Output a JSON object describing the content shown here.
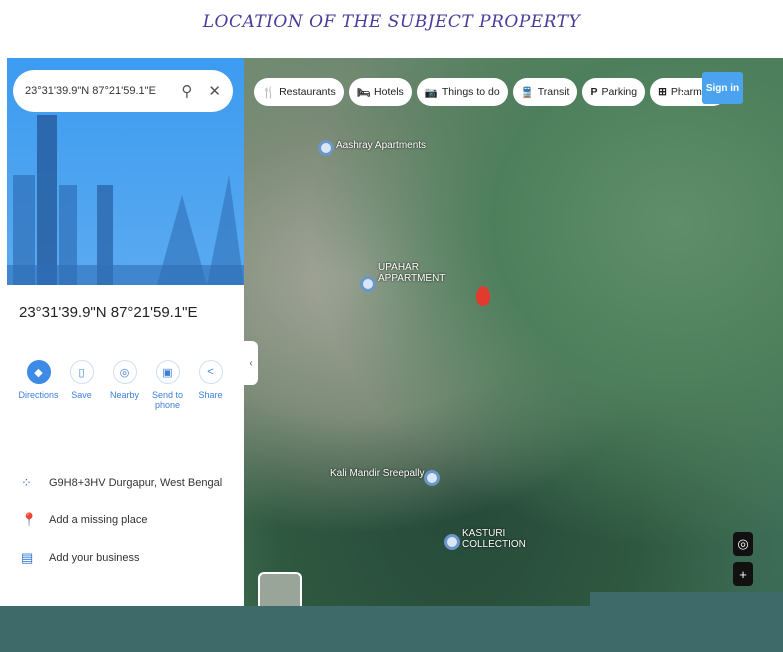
{
  "header": {
    "title": "LOCATION OF THE SUBJECT PROPERTY"
  },
  "search": {
    "value": "23°31'39.9\"N 87°21'59.1\"E",
    "search_icon": "search-icon",
    "close_icon": "close-icon"
  },
  "place": {
    "coordinates": "23°31'39.9\"N 87°21'59.1\"E"
  },
  "actions": [
    {
      "label": "Directions",
      "icon": "directions-icon"
    },
    {
      "label": "Save",
      "icon": "bookmark-icon"
    },
    {
      "label": "Nearby",
      "icon": "nearby-icon"
    },
    {
      "label": "Send to phone",
      "icon": "send-to-phone-icon"
    },
    {
      "label": "Share",
      "icon": "share-icon"
    }
  ],
  "info_rows": [
    {
      "label": "G9H8+3HV Durgapur, West Bengal",
      "icon": "plus-code-icon"
    },
    {
      "label": "Add a missing place",
      "icon": "add-place-icon"
    },
    {
      "label": "Add your business",
      "icon": "add-business-icon"
    }
  ],
  "chips": [
    {
      "label": "Restaurants",
      "icon": "🍴"
    },
    {
      "label": "Hotels",
      "icon": "🛏"
    },
    {
      "label": "Things to do",
      "icon": "📷"
    },
    {
      "label": "Transit",
      "icon": "🚆"
    },
    {
      "label": "Parking",
      "icon": "P"
    },
    {
      "label": "Pharmac",
      "icon": "⊞"
    }
  ],
  "map": {
    "sign_in": "Sign in",
    "labels": {
      "aashray": "Aashray Apartments",
      "upahar1": "UPAHAR",
      "upahar2": "APPARTMENT",
      "kali": "Kali Mandir Sreepally",
      "kasturi1": "KASTURI",
      "kasturi2": "COLLECTION"
    }
  },
  "colors": {
    "accent": "#3d8be6",
    "title": "#4b3a9a",
    "band": "#3e6b69",
    "pin": "#e23a2e"
  }
}
